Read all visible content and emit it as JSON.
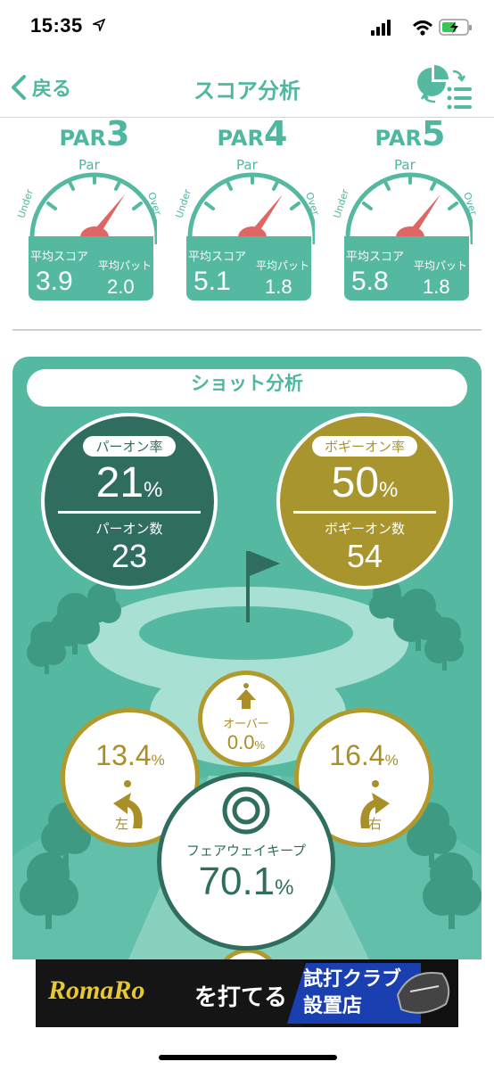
{
  "status_bar": {
    "time": "15:35"
  },
  "nav": {
    "back_label": "戻る",
    "title": "スコア分析"
  },
  "gauges": [
    {
      "prefix": "PAR",
      "par": "3",
      "scale_top": "Par",
      "scale_left": "Under",
      "scale_right": "Over",
      "avg_score_label": "平均スコア",
      "avg_score": "3.9",
      "avg_putt_label": "平均パット",
      "avg_putt": "2.0"
    },
    {
      "prefix": "PAR",
      "par": "4",
      "scale_top": "Par",
      "scale_left": "Under",
      "scale_right": "Over",
      "avg_score_label": "平均スコア",
      "avg_score": "5.1",
      "avg_putt_label": "平均パット",
      "avg_putt": "1.8"
    },
    {
      "prefix": "PAR",
      "par": "5",
      "scale_top": "Par",
      "scale_left": "Under",
      "scale_right": "Over",
      "avg_score_label": "平均スコア",
      "avg_score": "5.8",
      "avg_putt_label": "平均パット",
      "avg_putt": "1.8"
    }
  ],
  "shot_analysis": {
    "title": "ショット分析",
    "par_on": {
      "rate_label": "パーオン率",
      "rate": "21",
      "count_label": "パーオン数",
      "count": "23"
    },
    "bogey_on": {
      "rate_label": "ボギーオン率",
      "rate": "50",
      "count_label": "ボギーオン数",
      "count": "54"
    },
    "pct_sign": "%",
    "over": {
      "label": "オーバー",
      "value": "0.0"
    },
    "left": {
      "label": "左",
      "value": "13.4"
    },
    "right": {
      "label": "右",
      "value": "16.4"
    },
    "fairway": {
      "label": "フェアウェイキープ",
      "value": "70.1"
    }
  },
  "banner": {
    "brand": "RomaRo",
    "text": "を打てる",
    "badge_line1": "試打クラブ",
    "badge_line2": "設置店"
  },
  "colors": {
    "accent": "#4fb6a0",
    "panel": "#55b9a2",
    "dark_green": "#2f6e5f",
    "gold": "#a8952e",
    "needle": "#e06565"
  }
}
